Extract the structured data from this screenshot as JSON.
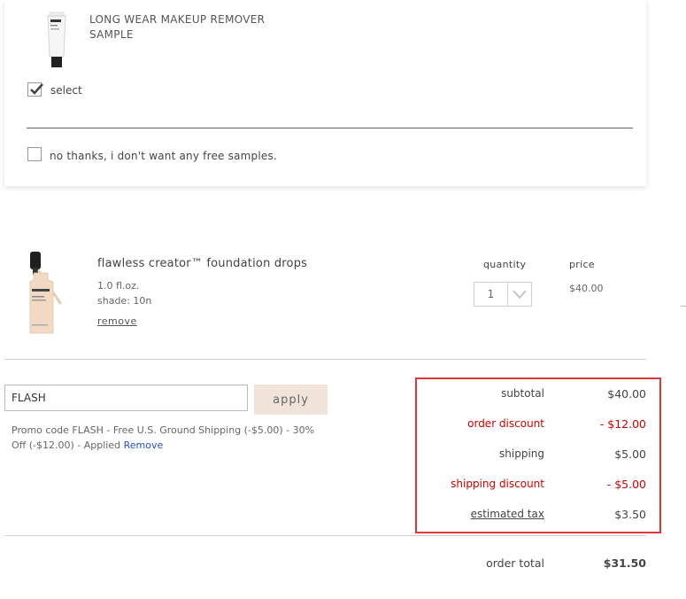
{
  "samples": {
    "sample_name": "LONG WEAR MAKEUP REMOVER SAMPLE",
    "select_label": "select",
    "no_thanks_label": "no thanks, i don't want any free samples."
  },
  "cart_item": {
    "name": "flawless creator™ foundation drops",
    "size": "1.0 fl.oz.",
    "shade": "shade: 10n",
    "remove_label": "remove",
    "quantity_header": "quantity",
    "price_header": "price",
    "quantity": "1",
    "price": "$40.00"
  },
  "promo": {
    "code_value": "FLASH",
    "apply_label": "apply",
    "note": "Promo code FLASH - Free U.S. Ground Shipping (-$5.00) - 30% Off (-$12.00) - Applied",
    "remove_label": "Remove"
  },
  "summary": {
    "subtotal_label": "subtotal",
    "subtotal_value": "$40.00",
    "order_discount_label": "order discount",
    "order_discount_value": "- $12.00",
    "shipping_label": "shipping",
    "shipping_value": "$5.00",
    "shipping_discount_label": "shipping discount",
    "shipping_discount_value": "- $5.00",
    "tax_label": "estimated tax",
    "tax_value": "$3.50",
    "total_label": "order total",
    "total_value": "$31.50"
  },
  "colors": {
    "discount_red": "#d40000",
    "highlight_border": "#e03838",
    "apply_button_bg": "#efe3da",
    "link_blue": "#2a4bd7"
  }
}
